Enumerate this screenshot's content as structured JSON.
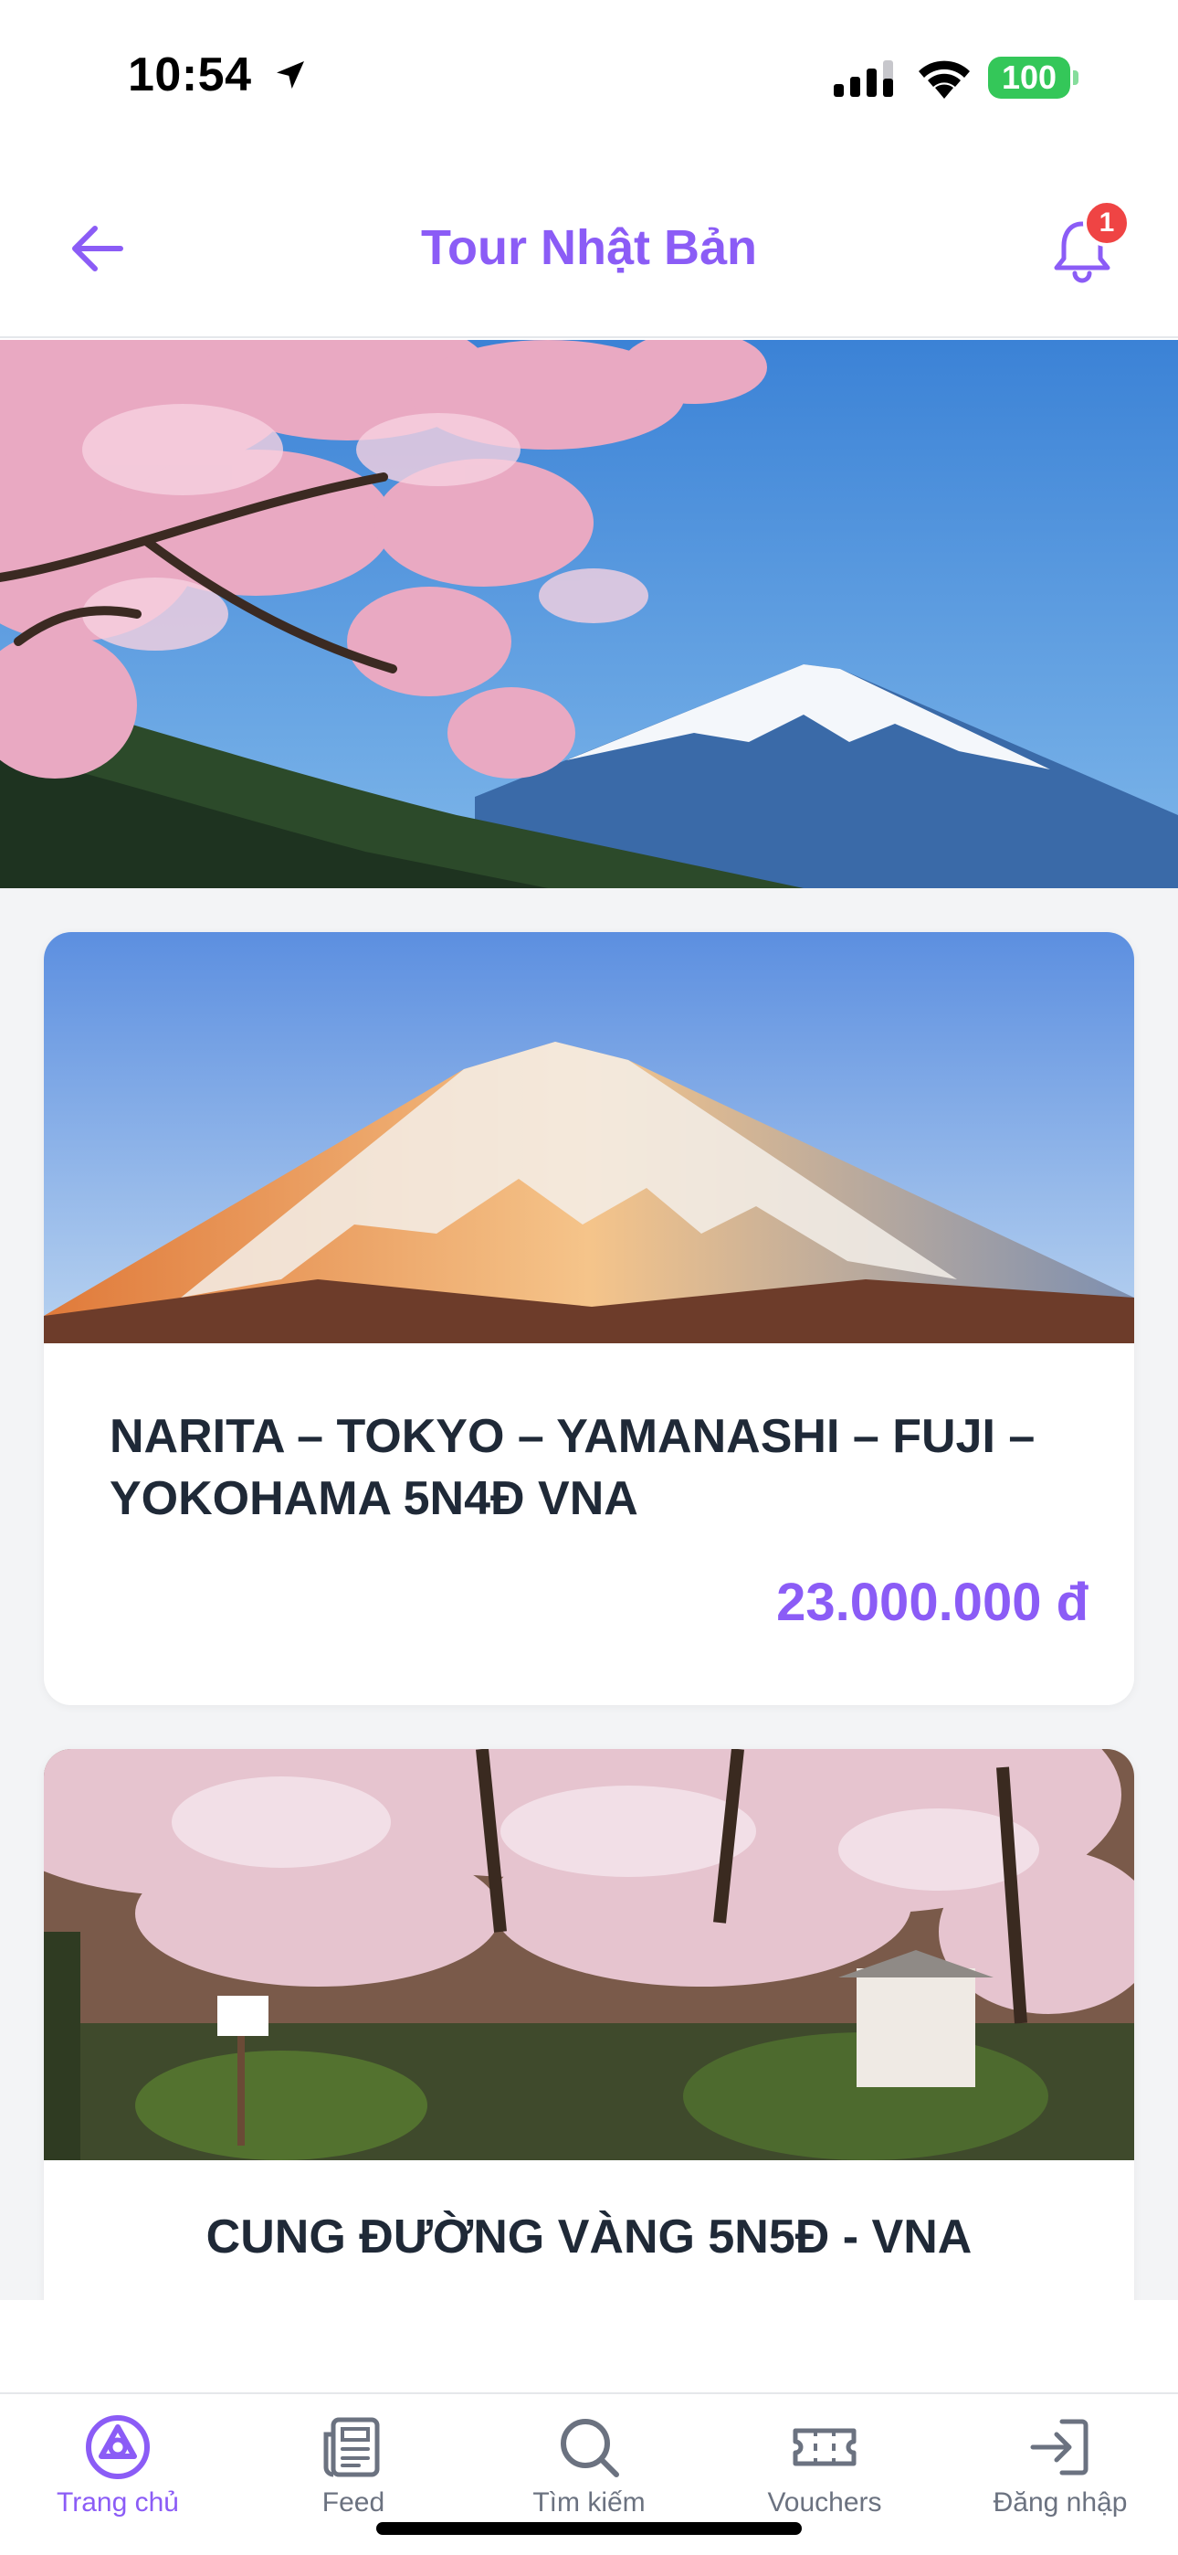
{
  "status_bar": {
    "time": "10:54",
    "battery": "100"
  },
  "header": {
    "title": "Tour Nhật Bản",
    "notification_count": "1"
  },
  "tours": [
    {
      "title": "NARITA – TOKYO – YAMANASHI – FUJI – YOKOHAMA 5N4Đ VNA",
      "price": "23.000.000 đ"
    },
    {
      "title": "CUNG ĐƯỜNG VÀNG 5N5Đ - VNA"
    }
  ],
  "tabbar": {
    "items": [
      {
        "label": "Trang chủ",
        "icon": "home-logo-icon",
        "active": true
      },
      {
        "label": "Feed",
        "icon": "newspaper-icon"
      },
      {
        "label": "Tìm kiếm",
        "icon": "search-icon"
      },
      {
        "label": "Vouchers",
        "icon": "ticket-icon"
      },
      {
        "label": "Đăng nhập",
        "icon": "login-icon"
      }
    ]
  },
  "colors": {
    "accent": "#8b5cf6",
    "badge": "#ef4444",
    "battery": "#34c759"
  }
}
